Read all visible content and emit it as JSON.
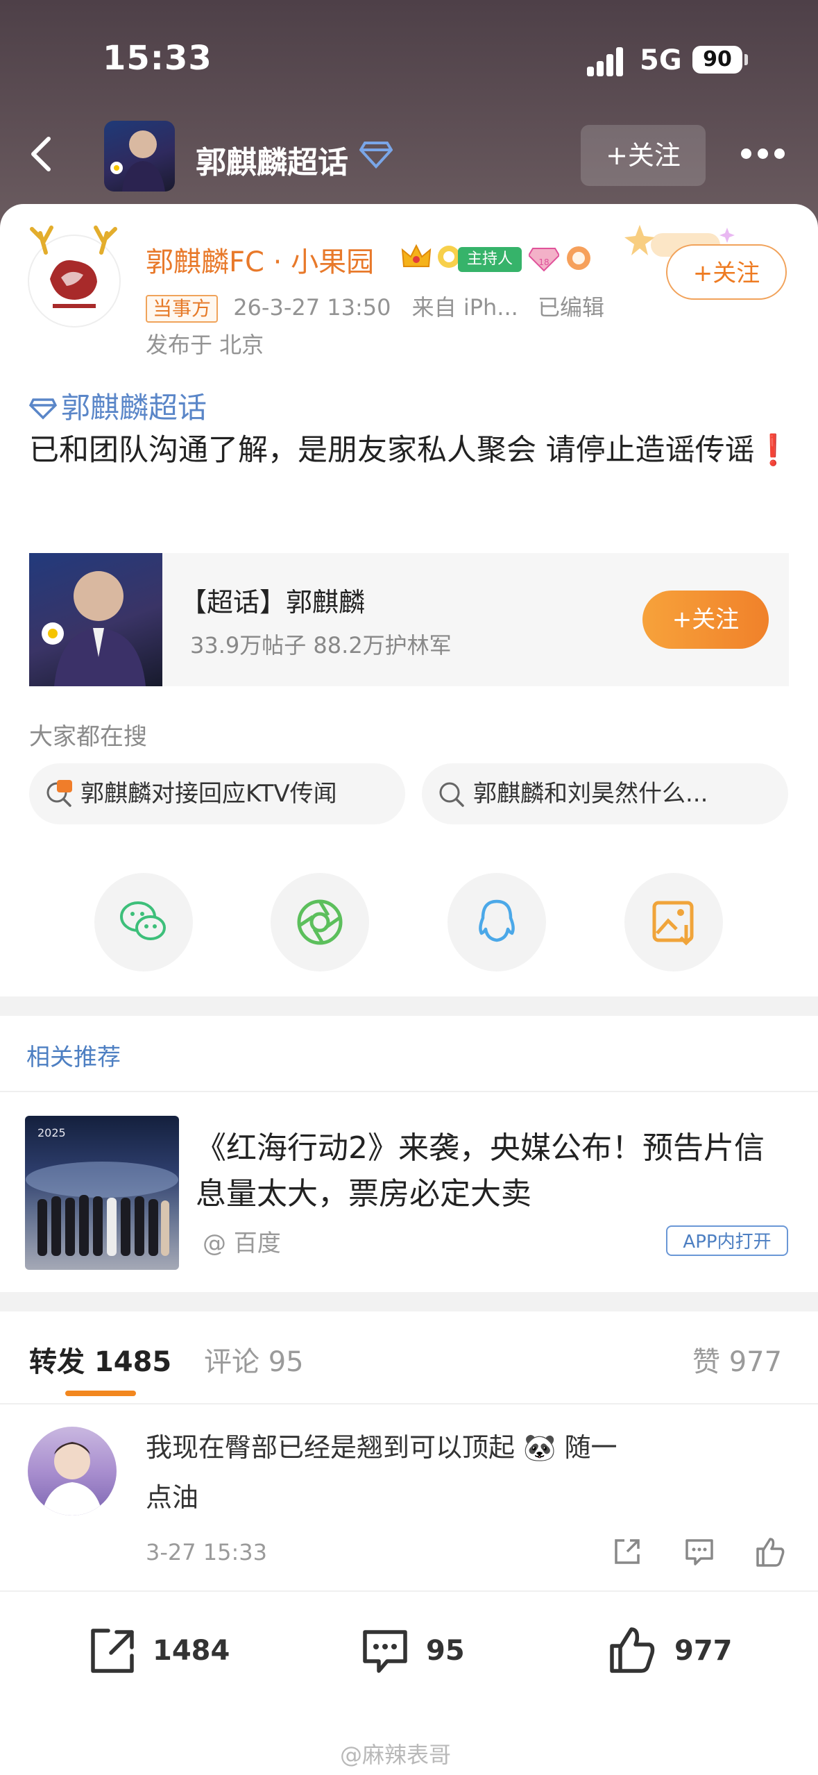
{
  "status": {
    "time": "15:33",
    "network": "5G",
    "battery": "90"
  },
  "nav": {
    "title": "郭麒麟超话",
    "follow": "+关注"
  },
  "post": {
    "author": "郭麒麟FC · 小果园",
    "host_badge": "主持人",
    "follow": "+关注",
    "tag": "当事方",
    "time": "26-3-27 13:50",
    "source": "来自 iPh...",
    "edited": "已编辑",
    "location": "发布于 北京",
    "topic": "郭麒麟超话",
    "text": "已和团队沟通了解，是朋友家私人聚会 请停止造谣传谣",
    "exclaim": "❗"
  },
  "supertopic": {
    "title": "【超话】郭麒麟",
    "stats": "33.9万帖子 88.2万护林军",
    "follow": "+关注"
  },
  "search": {
    "label": "大家都在搜",
    "chips": [
      "郭麒麟对接回应KTV传闻",
      "郭麒麟和刘昊然什么..."
    ]
  },
  "share_icons": [
    "wechat-icon",
    "moments-icon",
    "qq-icon",
    "save-image-icon"
  ],
  "recommend": {
    "label": "相关推荐",
    "title": "《红海行动2》来袭，央媒公布！预告片信息量太大，票房必定大卖",
    "source": "@ 百度",
    "app_button": "APP内打开"
  },
  "tabs": {
    "repost_label": "转发",
    "repost_count": "1485",
    "comment_label": "评论",
    "comment_count": "95",
    "like_label": "赞",
    "like_count": "977"
  },
  "comment": {
    "text": "我现在臀部已经是翘到可以顶起 🐼 随一点油",
    "time": "3-27 15:33"
  },
  "bottom": {
    "repost": "1484",
    "comment": "95",
    "like": "977"
  },
  "watermark": "@麻辣表哥",
  "colors": {
    "orange": "#f0812a",
    "blue_link": "#4d7fc2",
    "gray_text": "#939393"
  }
}
